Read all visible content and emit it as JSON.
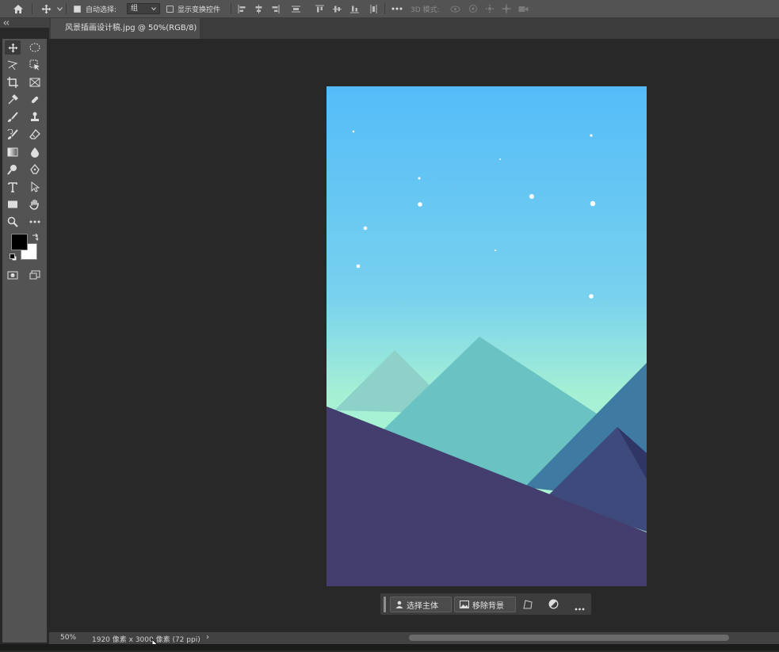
{
  "options_bar": {
    "auto_select_label": "自动选择:",
    "auto_select_value": "组",
    "show_transform_label": "显示变换控件",
    "three_d_mode_label": "3D 模式:",
    "auto_select_checked": true,
    "show_transform_checked": false
  },
  "document": {
    "tab_title": "风景插画设计稿.jpg @ 50%(RGB/8)"
  },
  "context_bar": {
    "select_subject": "选择主体",
    "remove_background": "移除背景"
  },
  "status": {
    "zoom": "50%",
    "doc_info": "1920 像素 x 3000 像素 (72 ppi)",
    "arrow": "›"
  },
  "colors": {
    "foreground": "#000000",
    "background": "#ffffff",
    "sky_top": "#54bcf8",
    "sky_bottom": "#b0f7d0",
    "ground": "#433e6d"
  }
}
